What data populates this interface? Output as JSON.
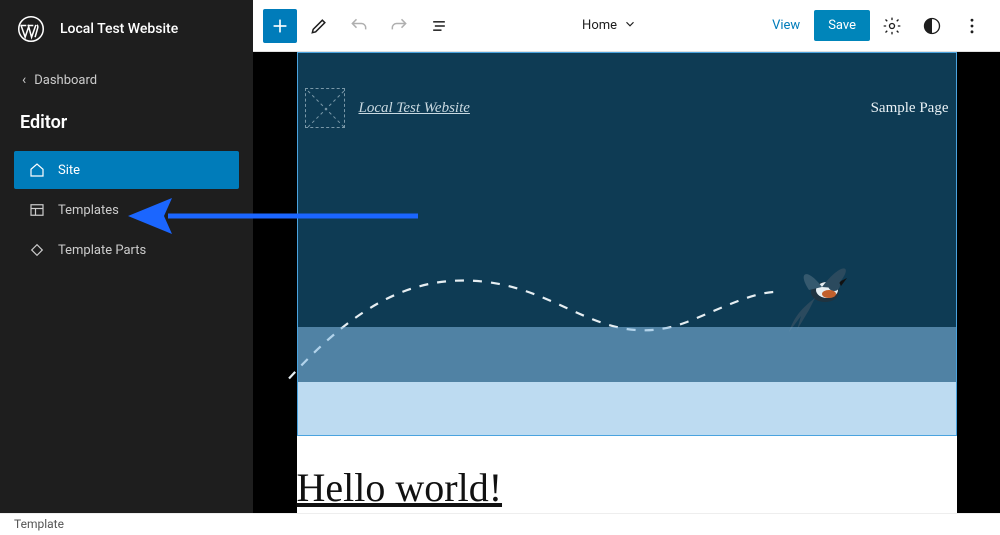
{
  "sidebar": {
    "site_name": "Local Test Website",
    "back_label": "Dashboard",
    "section_title": "Editor",
    "items": [
      {
        "label": "Site",
        "active": true
      },
      {
        "label": "Templates",
        "active": false
      },
      {
        "label": "Template Parts",
        "active": false
      }
    ]
  },
  "toolbar": {
    "template_label": "Home",
    "view_label": "View",
    "save_label": "Save"
  },
  "canvas": {
    "site_link": "Local Test Website",
    "nav_item": "Sample Page",
    "post_title": "Hello world!"
  },
  "status": {
    "breadcrumb": "Template"
  },
  "colors": {
    "accent": "#007cba",
    "sidebar_bg": "#1e1e1e",
    "hero_bg": "#0e3b54",
    "arrow": "#1b66ff"
  }
}
